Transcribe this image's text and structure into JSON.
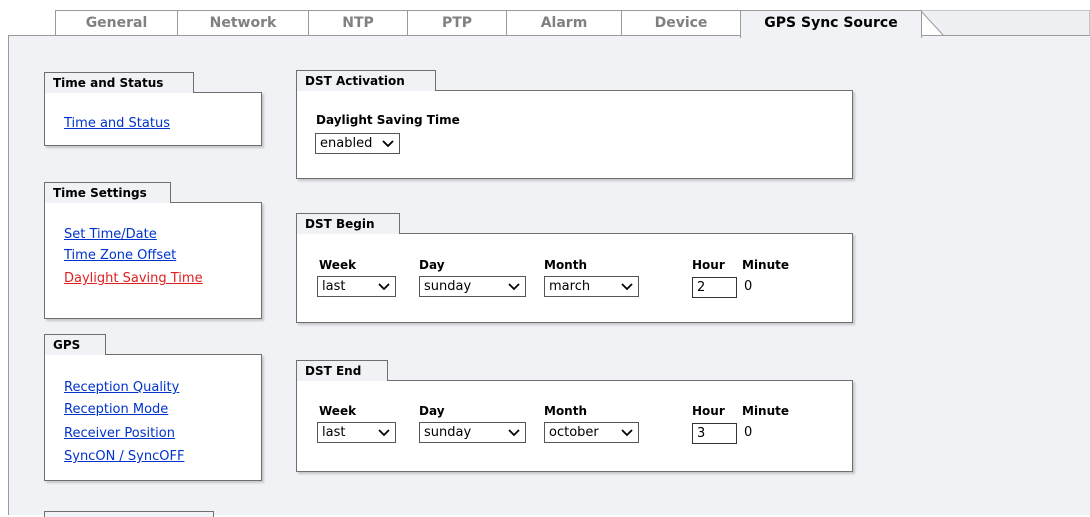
{
  "tabs": [
    {
      "label": "General"
    },
    {
      "label": "Network"
    },
    {
      "label": "NTP"
    },
    {
      "label": "PTP"
    },
    {
      "label": "Alarm"
    },
    {
      "label": "Device"
    },
    {
      "label": "GPS Sync Source",
      "active": true
    }
  ],
  "sidebar": {
    "time_status": {
      "title": "Time and Status",
      "links": [
        "Time and Status"
      ]
    },
    "time_settings": {
      "title": "Time Settings",
      "links": [
        "Set Time/Date",
        "Time Zone Offset",
        "Daylight Saving Time"
      ],
      "active": "Daylight Saving Time"
    },
    "gps": {
      "title": "GPS",
      "links": [
        "Reception Quality",
        "Reception Mode",
        "Receiver Position",
        "SyncON / SyncOFF"
      ]
    }
  },
  "dst_activation": {
    "title": "DST Activation",
    "field_label": "Daylight Saving Time",
    "value": "enabled"
  },
  "dst_begin": {
    "title": "DST Begin",
    "labels": {
      "week": "Week",
      "day": "Day",
      "month": "Month",
      "hour": "Hour",
      "minute": "Minute"
    },
    "week": "last",
    "day": "sunday",
    "month": "march",
    "hour": "2",
    "minute": "0"
  },
  "dst_end": {
    "title": "DST End",
    "labels": {
      "week": "Week",
      "day": "Day",
      "month": "Month",
      "hour": "Hour",
      "minute": "Minute"
    },
    "week": "last",
    "day": "sunday",
    "month": "october",
    "hour": "3",
    "minute": "0"
  },
  "colors": {
    "link": "#0033cc",
    "active_link": "#e02020",
    "panel_bg": "#f0f2f5"
  },
  "icons": {
    "dropdown": "chevron-down-icon"
  }
}
